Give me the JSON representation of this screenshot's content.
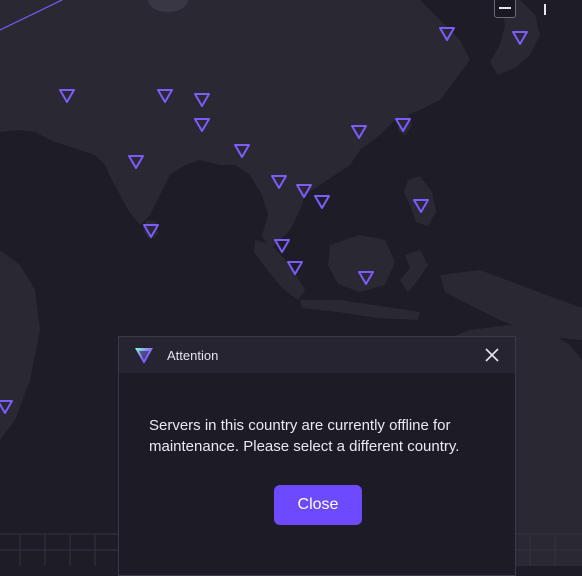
{
  "dialog": {
    "title": "Attention",
    "message": "Servers in this country are currently offline for maintenance. Please select a different country.",
    "close_button_label": "Close",
    "icons": {
      "logo": "proton-vpn-logo-icon",
      "close": "close-icon"
    }
  },
  "map": {
    "icons": {
      "zoom_out": "minus-icon",
      "server_marker": "server-location-marker-icon"
    }
  },
  "colors": {
    "background": "#1e1c26",
    "land": "#2a2833",
    "marker": "#7a5cff",
    "accent": "#6d4aff",
    "dialog_bg": "#1d1b25",
    "dialog_header": "#262431"
  }
}
